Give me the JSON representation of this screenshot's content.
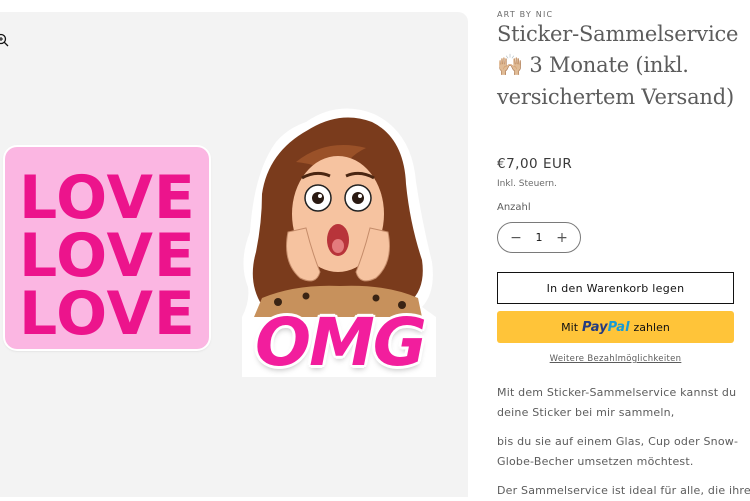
{
  "product": {
    "vendor": "ART BY NIC",
    "title": "Sticker-Sammelservice 🙌🏼 3 Monate (inkl. versichertem Versand)",
    "price": "€7,00 EUR",
    "tax_note": "Inkl. Steuern.",
    "quantity_label": "Anzahl",
    "quantity_value": "1",
    "quantity_minus": "−",
    "quantity_plus": "+",
    "add_to_cart": "In den Warenkorb legen",
    "paypal": {
      "prefix": "Mit",
      "logo_pay": "Pay",
      "logo_pal": "Pal",
      "suffix": "zahlen"
    },
    "more_payment": "Weitere Bezahlmöglichkeiten",
    "description": [
      "Mit dem Sticker-Sammelservice kannst du deine Sticker bei mir sammeln,",
      "bis du sie auf einem Glas, Cup oder Snow-Globe-Becher umsetzen möchtest.",
      "Der Sammelservice ist ideal für alle, die ihre"
    ]
  },
  "media": {
    "sticker_love_lines": [
      "LOVE",
      "LOVE",
      "LOVE"
    ],
    "sticker_omg_text": "OMG",
    "icons": {
      "zoom": "zoom-icon"
    }
  },
  "colors": {
    "accent_pink": "#ec148c",
    "love_sticker_bg": "#fbb6e2",
    "paypal_yellow": "#ffc439",
    "paypal_dark": "#253b80",
    "paypal_light": "#179bd7"
  }
}
